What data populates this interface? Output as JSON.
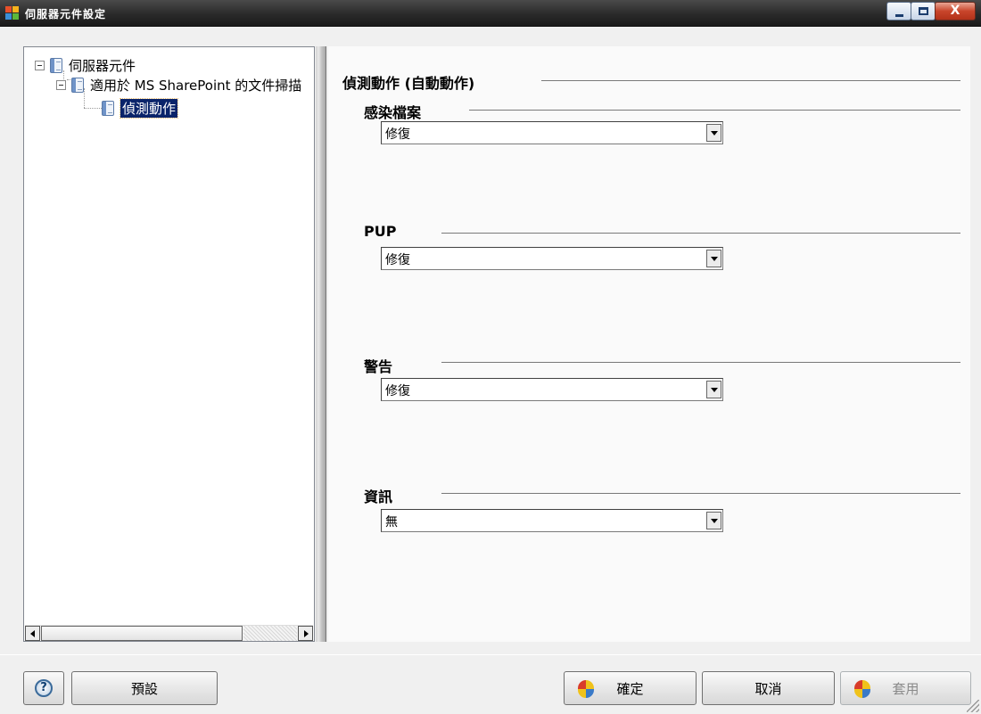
{
  "window": {
    "title": "伺服器元件設定",
    "controls": {
      "minimize": "minimize",
      "maximize": "maximize",
      "close": "X"
    }
  },
  "tree": {
    "items": [
      {
        "label": "伺服器元件",
        "expanded": true
      },
      {
        "label": "適用於 MS SharePoint 的文件掃描",
        "expanded": true
      },
      {
        "label": "偵測動作",
        "selected": true
      }
    ]
  },
  "content": {
    "main_title": "偵測動作 (自動動作)",
    "sections": [
      {
        "label": "感染檔案",
        "value": "修復"
      },
      {
        "label": "PUP",
        "value": "修復"
      },
      {
        "label": "警告",
        "value": "修復"
      },
      {
        "label": "資訊",
        "value": "無"
      }
    ]
  },
  "buttons": {
    "help": "?",
    "default": "預設",
    "ok": "確定",
    "cancel": "取消",
    "apply": "套用"
  },
  "colors": {
    "title_bar": "#2a2a2a",
    "selection": "#0a246a",
    "close_button": "#c8452b"
  }
}
